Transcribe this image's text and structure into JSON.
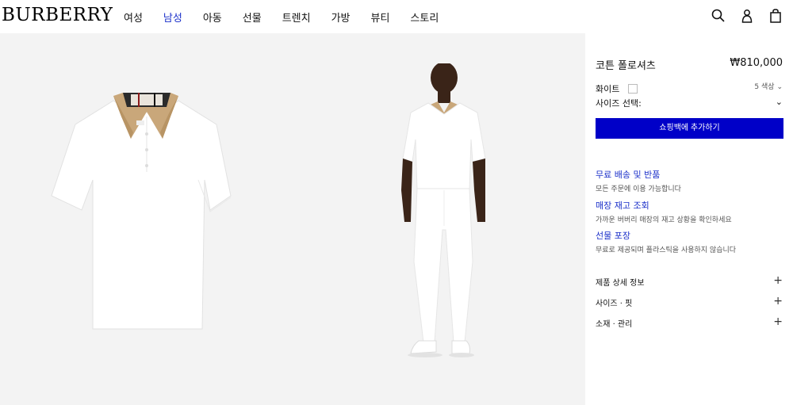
{
  "header": {
    "logo": "BURBERRY",
    "nav": [
      "여성",
      "남성",
      "아동",
      "선물",
      "트렌치",
      "가방",
      "뷰티",
      "스토리"
    ],
    "active_nav": "남성",
    "icons": [
      "search-icon",
      "account-icon",
      "shopping-bag-icon"
    ]
  },
  "product": {
    "name": "코튼 폴로셔츠",
    "price": "₩810,000",
    "color_name": "화이트",
    "color_count": "5 색상",
    "size_label": "사이즈 선택:",
    "add_to_bag": "쇼핑백에 추가하기"
  },
  "services": [
    {
      "title": "무료 배송 및 반품",
      "desc": "모든 주문에 이용 가능합니다"
    },
    {
      "title": "매장 재고 조회",
      "desc": "가까운 버버리 매장의 재고 상황을 확인하세요"
    },
    {
      "title": "선물 포장",
      "desc": "무료로 제공되며 플라스틱을 사용하지 않습니다"
    }
  ],
  "accordions": [
    "제품 상세 정보",
    "사이즈 · 핏",
    "소재 · 관리"
  ],
  "colors": {
    "accent": "#0000c8",
    "link": "#1a2fc9",
    "gallery_bg": "#f3f3f3"
  }
}
